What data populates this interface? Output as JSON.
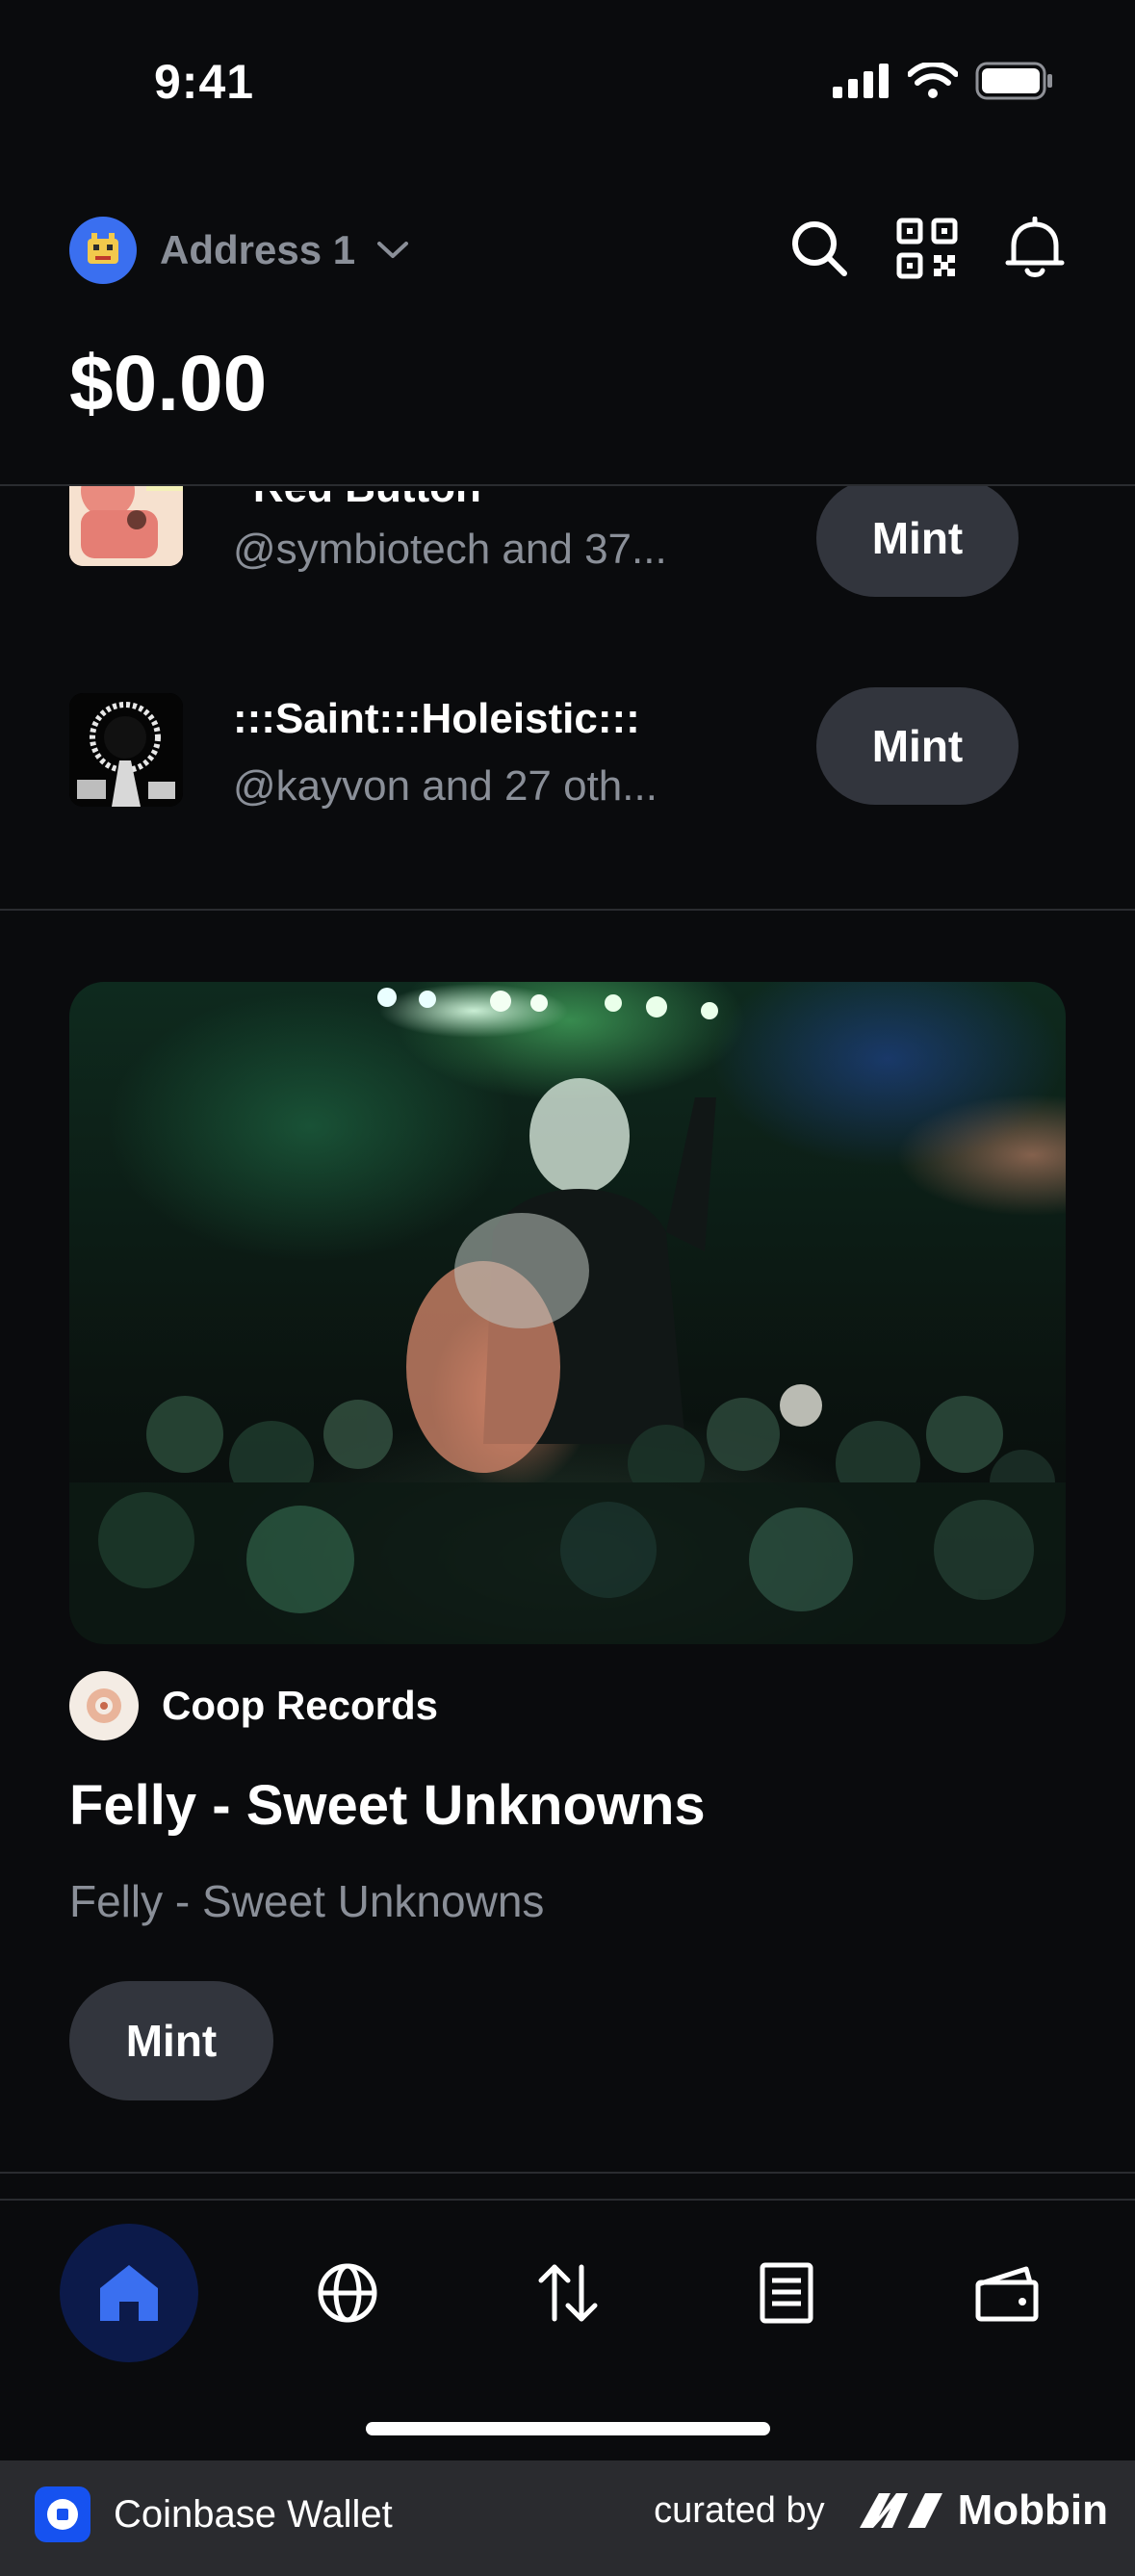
{
  "status": {
    "time": "9:41"
  },
  "header": {
    "address_label": "Address 1",
    "balance": "$0.00"
  },
  "list": [
    {
      "title": "\"Red Button\"",
      "subtitle": "@symbiotech and 37...",
      "button": "Mint"
    },
    {
      "title": ":::Saint:::Holeistic:::",
      "subtitle": "@kayvon and 27 oth...",
      "button": "Mint"
    }
  ],
  "feature": {
    "creator": "Coop Records",
    "title": "Felly - Sweet Unknowns",
    "description": "Felly - Sweet Unknowns",
    "button": "Mint"
  },
  "nav": {
    "items": [
      "home-icon",
      "globe-icon",
      "swap-icon",
      "activity-icon",
      "wallet-icon"
    ],
    "active": "home-icon"
  },
  "footer": {
    "app_name": "Coinbase Wallet",
    "curated_by": "curated by",
    "brand": "Mobbin"
  },
  "colors": {
    "background": "#0a0b0d",
    "button_bg": "#32353d",
    "muted_text": "#8a8f98",
    "accent_blue": "#3a6ff0",
    "nav_active_bg": "#0c1a4a"
  }
}
